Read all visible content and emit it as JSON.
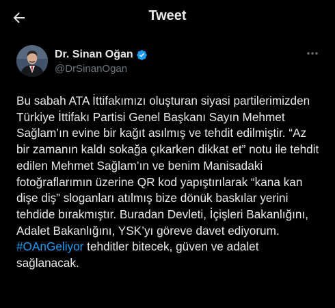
{
  "header": {
    "title": "Tweet",
    "back_icon": "arrow-left-icon"
  },
  "author": {
    "display_name": "Dr. Sinan Oğan",
    "handle": "@DrSinanOgan",
    "verified": true,
    "verified_icon": "verified-badge-icon",
    "more_icon": "more-horizontal-icon"
  },
  "tweet": {
    "body": "Bu sabah ATA İttifakımızı oluşturan siyasi partilerimizden Türkiye İttifakı Partisi Genel Başkanı Sayın Mehmet Sağlam’ın evine bir kağıt asılmış ve tehdit edilmiştir. “Az bir zamanın kaldı sokağa çıkarken dikkat et” notu ile tehdit edilen Mehmet Sağlam’ın ve benim Manisadaki fotoğraflarımın üzerine QR kod yapıştırılarak “kana kan dişe diş” sloganları atılmış bize dönük baskılar yerini tehdide bırakmıştır. Buradan Devleti, İçişleri Bakanlığını, Adalet Bakanlığını, YSK’yı göreve davet ediyorum.",
    "hashtag": "#OAnGeliyor",
    "tail": " tehditler bitecek, güven ve adalet sağlanacak."
  },
  "colors": {
    "background": "#000000",
    "text": "#e7e9ea",
    "secondary": "#71767b",
    "accent": "#1d9bf0"
  }
}
